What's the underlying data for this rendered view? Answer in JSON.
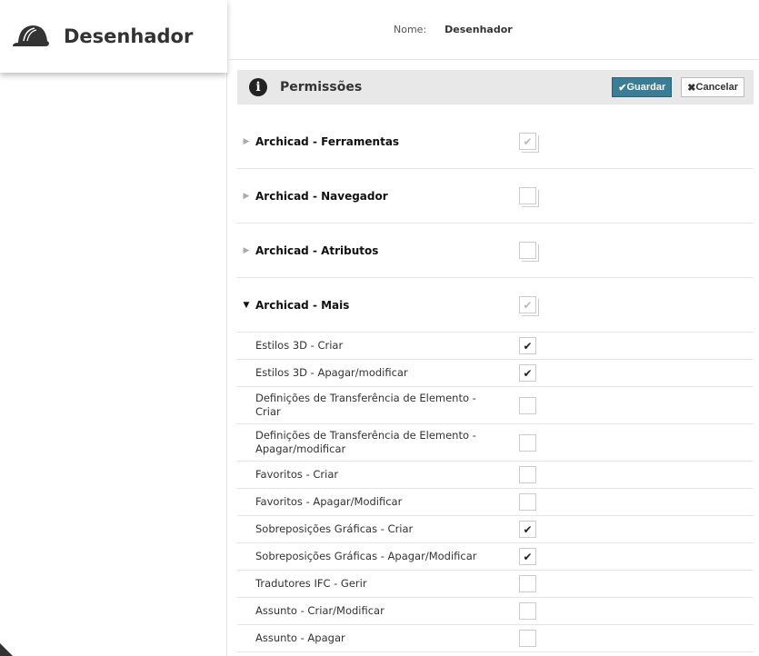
{
  "sidebar": {
    "title": "Desenhador",
    "icon": "hard-hat-icon"
  },
  "nome": {
    "label": "Nome:",
    "value": "Desenhador"
  },
  "panel": {
    "title": "Permissões",
    "save_label": "Guardar",
    "cancel_label": "Cancelar"
  },
  "groups": [
    {
      "label": "Archicad - Ferramentas",
      "expanded": false,
      "checked": true
    },
    {
      "label": "Archicad - Navegador",
      "expanded": false,
      "checked": false
    },
    {
      "label": "Archicad - Atributos",
      "expanded": false,
      "checked": false
    },
    {
      "label": "Archicad - Mais",
      "expanded": true,
      "checked": true
    }
  ],
  "items": [
    {
      "label": "Estilos 3D - Criar",
      "checked": true
    },
    {
      "label": "Estilos 3D - Apagar/modificar",
      "checked": true
    },
    {
      "label": "Definições de Transferência de Elemento - Criar",
      "checked": false
    },
    {
      "label": "Definições de Transferência de Elemento - Apagar/modificar",
      "checked": false
    },
    {
      "label": "Favoritos - Criar",
      "checked": false
    },
    {
      "label": "Favoritos - Apagar/Modificar",
      "checked": false
    },
    {
      "label": "Sobreposições Gráficas - Criar",
      "checked": true
    },
    {
      "label": "Sobreposições Gráficas - Apagar/Modificar",
      "checked": true
    },
    {
      "label": "Tradutores IFC - Gerir",
      "checked": false
    },
    {
      "label": "Assunto - Criar/Modificar",
      "checked": false
    },
    {
      "label": "Assunto - Apagar",
      "checked": false
    }
  ]
}
